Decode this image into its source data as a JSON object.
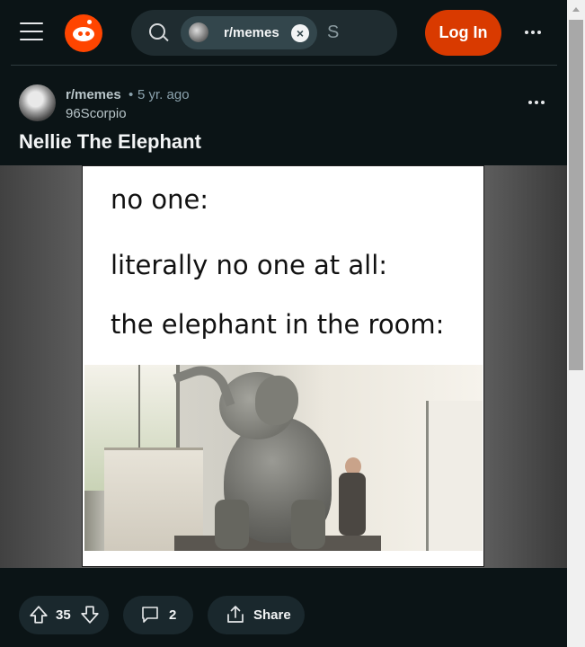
{
  "header": {
    "search_chip_label": "r/memes",
    "search_chip_close": "×",
    "search_typed": "S",
    "login_label": "Log In"
  },
  "post": {
    "subreddit": "r/memes",
    "separator": "•",
    "age": "5 yr. ago",
    "author": "96Scorpio",
    "title": "Nellie The Elephant",
    "meme_lines": [
      "no one:",
      "literally no one at all:",
      "the elephant in the room:"
    ]
  },
  "actions": {
    "score": "35",
    "comments": "2",
    "share_label": "Share"
  },
  "colors": {
    "background": "#0b1416",
    "brand": "#ff4500",
    "login": "#d93a00",
    "pill": "#1a282d"
  }
}
